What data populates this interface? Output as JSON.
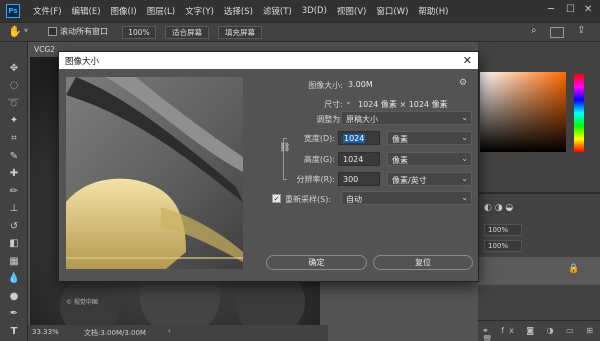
{
  "menu": {
    "logo": "Ps",
    "items": [
      "文件(F)",
      "编辑(E)",
      "图像(I)",
      "图层(L)",
      "文字(Y)",
      "选择(S)",
      "滤镜(T)",
      "3D(D)",
      "视图(V)",
      "窗口(W)",
      "帮助(H)"
    ]
  },
  "options": {
    "scroll_all": "滚动所有窗口",
    "zoom_100": "100%",
    "fit_screen": "适合屏幕",
    "fill_screen": "填充屏幕"
  },
  "document": {
    "tab": "VCG2",
    "watermark": "© 视觉中国",
    "zoom": "33.33%",
    "doc_info": "文档:3.00M/3.00M"
  },
  "dialog": {
    "title": "图像大小",
    "image_size_label": "图像大小:",
    "image_size_value": "3.00M",
    "dimensions_label": "尺寸:",
    "dimensions_value": "1024 像素 × 1024 像素",
    "fit_to_label": "调整为:",
    "fit_to_value": "原稿大小",
    "width_label": "宽度(D):",
    "width_value": "1024",
    "width_unit": "像素",
    "height_label": "高度(G):",
    "height_value": "1024",
    "height_unit": "像素",
    "resolution_label": "分辨率(R):",
    "resolution_value": "300",
    "resolution_unit": "像素/英寸",
    "resample_label": "重新采样(S):",
    "resample_checked": true,
    "resample_value": "自动",
    "ok_label": "确定",
    "reset_label": "复位"
  },
  "layers": {
    "opacity_1": "100%",
    "opacity_2": "100%"
  },
  "colors": {
    "accent": "#1c5ea9",
    "ps_blue": "#31a8ff"
  }
}
